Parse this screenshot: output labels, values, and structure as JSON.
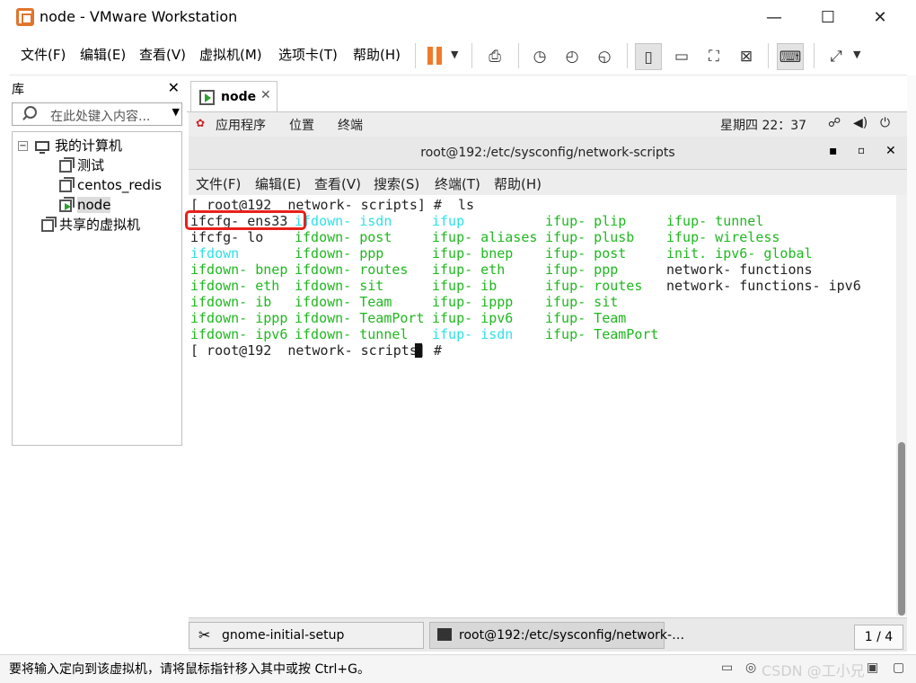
{
  "window": {
    "title": "node - VMware Workstation",
    "minimize": "—",
    "maximize": "☐",
    "close": "✕"
  },
  "menu": [
    "文件(F)",
    "编辑(E)",
    "查看(V)",
    "虚拟机(M)",
    "选项卡(T)",
    "帮助(H)"
  ],
  "library": {
    "title": "库",
    "close": "✕",
    "search_placeholder": "在此处键入内容...",
    "tree": {
      "root": "我的计算机",
      "vms": [
        "测试",
        "centos_redis",
        "node"
      ],
      "shared": "共享的虚拟机"
    }
  },
  "vm_tab": {
    "label": "node",
    "close": "✕"
  },
  "gnome": {
    "apps": "应用程序",
    "places": "位置",
    "terminal": "终端",
    "clock": "星期四 22：37"
  },
  "terminal": {
    "window_title": "root@192:/etc/sysconfig/network-scripts",
    "menu": [
      "文件(F)",
      "编辑(E)",
      "查看(V)",
      "搜索(S)",
      "终端(T)",
      "帮助(H)"
    ],
    "prompt1": "[ root@192  network- scripts] #  ls",
    "prompt2": "[ root@192  network- scripts] # ",
    "columns": [
      [
        "ifcfg- ens33",
        "ifcfg- lo",
        "ifdown",
        "ifdown- bnep",
        "ifdown- eth",
        "ifdown- ib",
        "ifdown- ippp",
        "ifdown- ipv6"
      ],
      [
        "ifdown- isdn",
        "ifdown- post",
        "ifdown- ppp",
        "ifdown- routes",
        "ifdown- sit",
        "ifdown- Team",
        "ifdown- TeamPort",
        "ifdown- tunnel"
      ],
      [
        "ifup",
        "ifup- aliases",
        "ifup- bnep",
        "ifup- eth",
        "ifup- ib",
        "ifup- ippp",
        "ifup- ipv6",
        "ifup- isdn"
      ],
      [
        "ifup- plip",
        "ifup- plusb",
        "ifup- post",
        "ifup- ppp",
        "ifup- routes",
        "ifup- sit",
        "ifup- Team",
        "ifup- TeamPort"
      ],
      [
        "ifup- tunnel",
        "ifup- wireless",
        "init. ipv6- global",
        "network- functions",
        "network- functions- ipv6",
        "",
        "",
        ""
      ]
    ],
    "colors": {
      "green": "#1fb81f",
      "cyan": "#2ee0e8",
      "default": "#222222"
    }
  },
  "taskbar": {
    "tasks": [
      "gnome-initial-setup",
      "root@192:/etc/sysconfig/network-…"
    ],
    "pager": "1 / 4"
  },
  "status": {
    "message": "要将输入定向到该虚拟机，请将鼠标指针移入其中或按 Ctrl+G。",
    "watermark": "CSDN @工小兄"
  }
}
